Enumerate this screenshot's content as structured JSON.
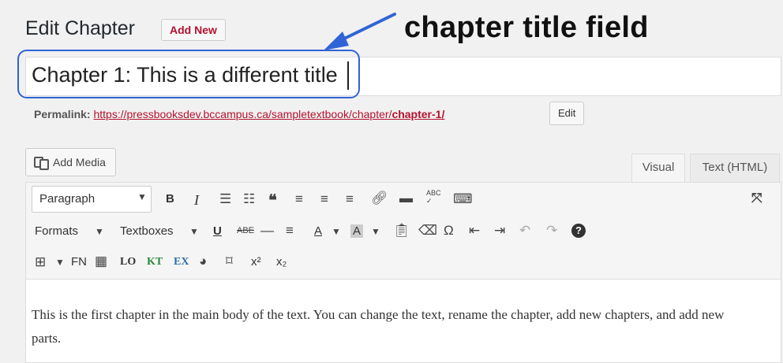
{
  "header": {
    "title": "Edit Chapter",
    "add_new": "Add New"
  },
  "annotation": {
    "label": "chapter title field",
    "arrow_color": "#2f64d6"
  },
  "title_field": {
    "value": "Chapter 1: This is a different title"
  },
  "permalink": {
    "label": "Permalink:",
    "url_base": "https://pressbooksdev.bccampus.ca/sampletextbook/chapter/",
    "slug": "chapter-1/",
    "edit_label": "Edit"
  },
  "media": {
    "add_media_label": "Add Media"
  },
  "tabs": [
    {
      "label": "Visual"
    },
    {
      "label": "Text (HTML)"
    }
  ],
  "toolbar": {
    "paragraph_select": "Paragraph",
    "bold": "B",
    "italic": "I",
    "formats": "Formats",
    "textboxes": "Textboxes",
    "fn": "FN",
    "lo": "LO",
    "kt": "KT",
    "ex": "EX",
    "superscript": "x²",
    "subscript": "x₂",
    "text_color": "A",
    "bg_color": "A",
    "abc": "ABC"
  },
  "content": {
    "paragraph": "This is the first chapter in the main body of the text. You can change the text, rename the chapter, add new chapters, and add new parts."
  },
  "colors": {
    "accent": "#b3122e",
    "highlight": "#2f64d6"
  }
}
